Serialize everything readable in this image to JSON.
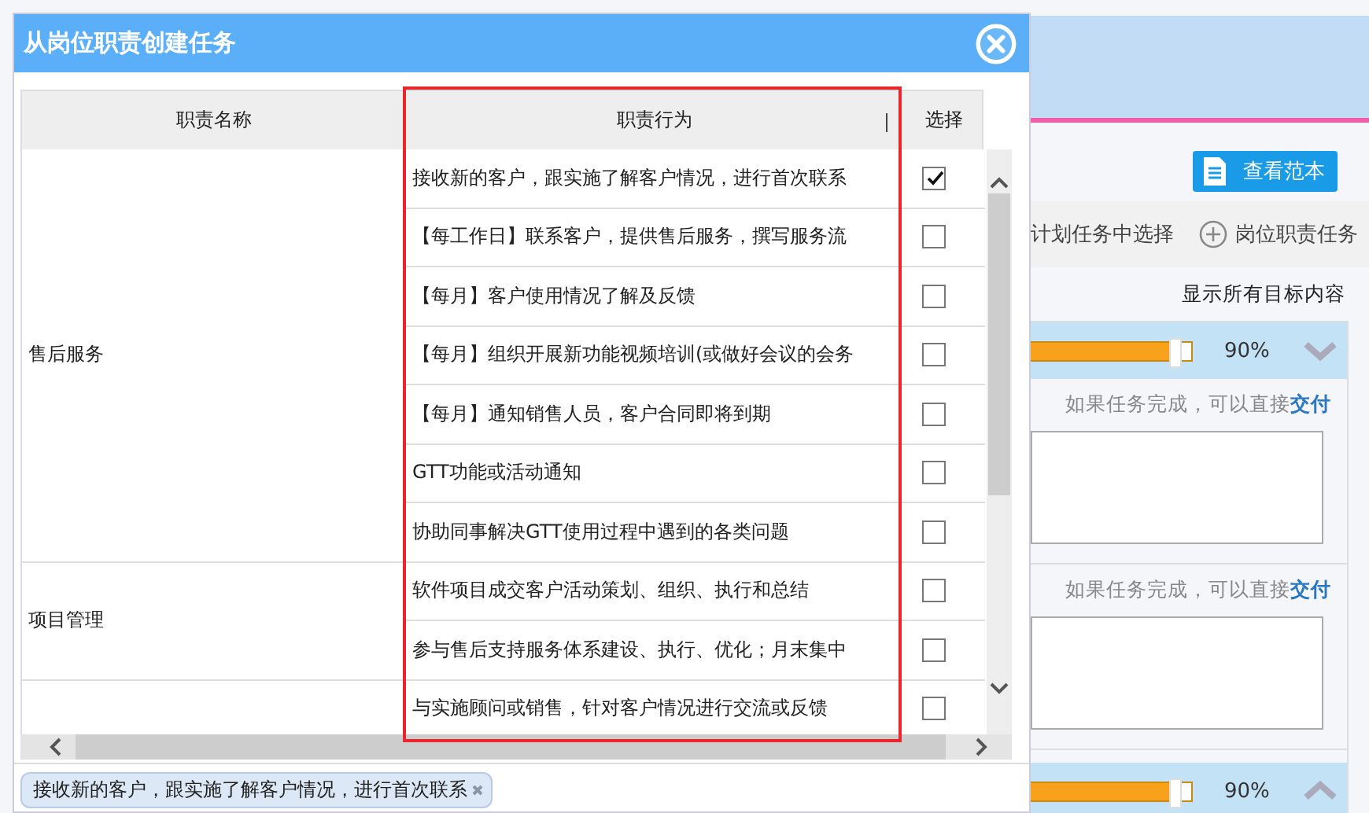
{
  "dialog": {
    "title": "从岗位职责创建任务",
    "columns": [
      {
        "label": "职责名称"
      },
      {
        "label": "职责行为"
      },
      {
        "label": "选择"
      }
    ],
    "groups": [
      {
        "name": "售后服务",
        "rows": [
          {
            "text": "接收新的客户，跟实施了解客户情况，进行首次联系",
            "checked": true
          },
          {
            "text": "【每工作日】联系客户，提供售后服务，撰写服务流",
            "checked": false
          },
          {
            "text": "【每月】客户使用情况了解及反馈",
            "checked": false
          },
          {
            "text": "【每月】组织开展新功能视频培训(或做好会议的会务",
            "checked": false
          },
          {
            "text": "【每月】通知销售人员，客户合同即将到期",
            "checked": false
          },
          {
            "text": "GTT功能或活动通知",
            "checked": false
          },
          {
            "text": "协助同事解决GTT使用过程中遇到的各类问题",
            "checked": false
          }
        ]
      },
      {
        "name": "项目管理",
        "rows": [
          {
            "text": "软件项目成交客户活动策划、组织、执行和总结",
            "checked": false
          },
          {
            "text": "参与售后支持服务体系建设、执行、优化；月末集中",
            "checked": false
          }
        ]
      },
      {
        "rows": [
          {
            "text": "与实施顾问或销售，针对客户情况进行交流或反馈",
            "checked": false
          }
        ]
      }
    ],
    "selected_tags": [
      {
        "text": "接收新的客户，跟实施了解客户情况，进行首次联系"
      }
    ]
  },
  "page": {
    "sample_button": "查看范本",
    "toolbar": [
      {
        "label": "计划任务中选择",
        "kind": "plain"
      },
      {
        "label": "岗位职责任务",
        "kind": "add"
      }
    ],
    "filter_link": "显示所有目标内容",
    "tasks": [
      {
        "level": 0.9,
        "reading": "90%",
        "expanded": false,
        "notes": [
          {
            "hint": "如果任务完成，可以直接",
            "action": "交付"
          },
          {
            "hint": "如果任务完成，可以直接",
            "action": "交付"
          }
        ]
      },
      {
        "level": 0.9,
        "reading": "90%",
        "expanded": true
      }
    ]
  }
}
